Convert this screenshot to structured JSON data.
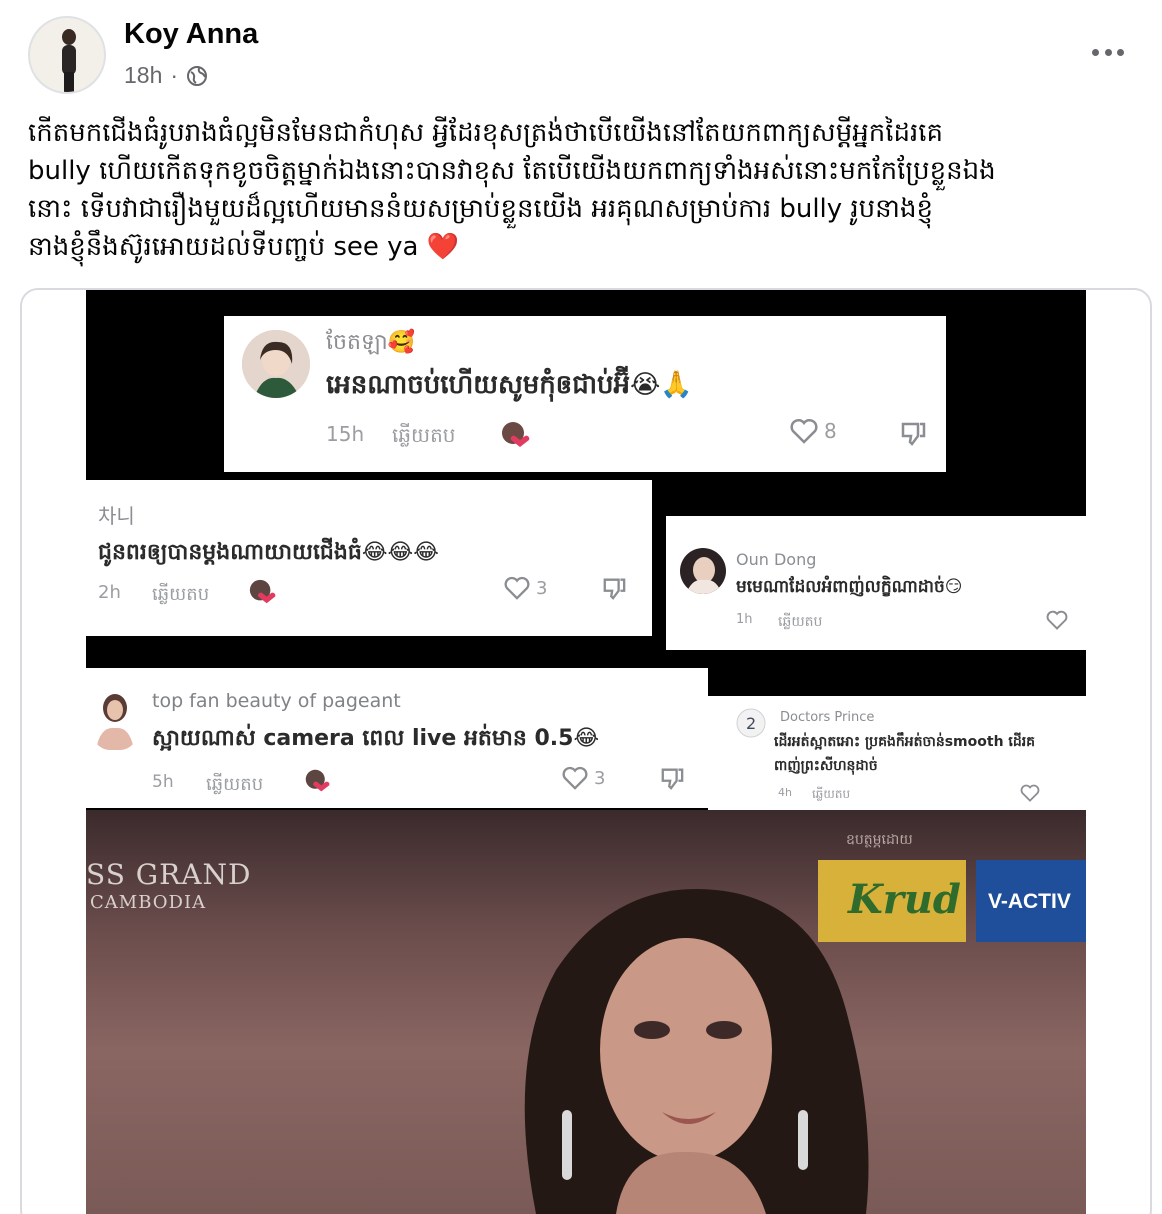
{
  "post": {
    "author": "Koy Anna",
    "time": "18h",
    "time_separator": "·",
    "audience_icon": "globe-icon",
    "more_icon": "more-options-icon",
    "caption_lines": [
      "កើតមកជើងធំរូបរាងធំល្អមិនមែនជាកំហុស អ្វីដែរខុសត្រង់ថាបើយើងនៅតែយកពាក្យសម្ដីអ្នកដៃរគេ",
      "bully ហើយកើតទុកខូចចិត្តម្នាក់ឯងនោះបានវាខុស តែបើយើងយកពាក្យទាំងអស់នោះមកកែប្រែខ្លួនឯង",
      "នោះ ទើបវាជារឿងមួយដ៏ល្អហើយមាននំយសម្រាប់ខ្លួនយើង  អរគុណសម្រាប់ការ bully រូបនាងខ្ញុំ",
      "នាងខ្ញុំនឹងស៊ូរអោយដល់ទីបញ្ចប់ see ya"
    ],
    "caption_emoji": "❤️"
  },
  "comments": [
    {
      "name": "ចែតឡា🥰",
      "text": "អេនណាចប់ហើយសូមកុំឲជាប់អ៊ី😭🙏",
      "time": "15h",
      "reply": "ឆ្លើយតប",
      "likes": "8"
    },
    {
      "name": "차니",
      "text": "ជូនពរឲ្យបានម្ដងណាយាយជើងធំ😂😂😂",
      "time": "2h",
      "reply": "ឆ្លើយតប",
      "likes": "3"
    },
    {
      "name": "Oun Dong",
      "text": "មមេណាដែលអំពាញ់លក្ខិណាដាច់😏",
      "time": "1h",
      "reply": "ឆ្លើយតប",
      "likes": ""
    },
    {
      "name": "top fan beauty of pageant",
      "text": "ស្អាយណាស់ camera ពេល live អត់មាន 0.5😂",
      "time": "5h",
      "reply": "ឆ្លើយតប",
      "likes": "3"
    },
    {
      "name": "Doctors Prince",
      "text_lines": [
        "ដើរអត់ស្អាតអោះ ប្រគងកឹអត់ចាន់smooth ដើរគ",
        "ពាញ់ព្រះសីហនុដាច់"
      ],
      "time": "4h",
      "reply": "ឆ្លើយតប",
      "likes": ""
    }
  ],
  "photo": {
    "pageant_line1": "SS GRAND",
    "pageant_line2": "CAMBODIA",
    "sponsor_caption": "ឧបត្ថម្ភដោយ",
    "sponsor1": "Krud",
    "sponsor2": "V-ACTIV"
  },
  "colors": {
    "text_primary": "#050505",
    "text_secondary": "#65676b",
    "heart": "#e41e3f",
    "media_bg": "#000000",
    "frame_border": "#d9dadd"
  }
}
